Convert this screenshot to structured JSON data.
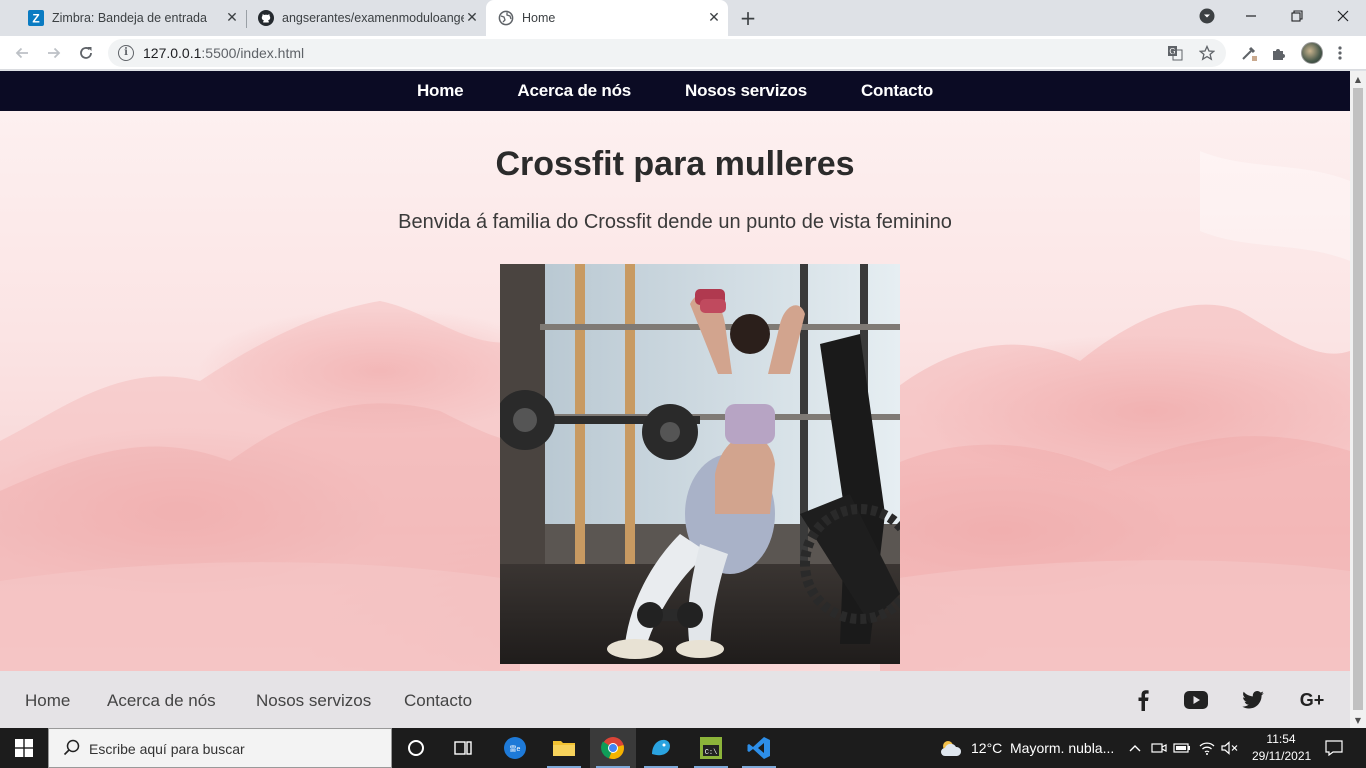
{
  "browser": {
    "tabs": [
      {
        "title": "Zimbra: Bandeja de entrada",
        "icon": "zimbra-icon"
      },
      {
        "title": "angserantes/examenmoduloangelserantes",
        "icon": "github-icon"
      },
      {
        "title": "Home",
        "icon": "globe-icon",
        "active": true
      }
    ],
    "url_host": "127.0.0.1",
    "url_rest": ":5500/index.html"
  },
  "site": {
    "nav": [
      "Home",
      "Acerca de nós",
      "Nosos servizos",
      "Contacto"
    ],
    "title": "Crossfit para mulleres",
    "subtitle": "Benvida á familia do Crossfit dende un punto de vista feminino",
    "footer_links": [
      "Home",
      "Acerca de nós",
      "Nosos servizos",
      "Contacto"
    ],
    "social": {
      "facebook": "facebook-icon",
      "youtube": "youtube-icon",
      "twitter": "twitter-icon",
      "googleplus": "G+"
    }
  },
  "taskbar": {
    "search_placeholder": "Escribe aquí para buscar",
    "weather_temp": "12°C",
    "weather_desc": "Mayorm. nubla...",
    "time": "11:54",
    "date": "29/11/2021"
  },
  "colors": {
    "nav_bg": "#0b0b24",
    "footer_bg": "#e5e3e6",
    "hero_tint": "#f7d4d4"
  }
}
